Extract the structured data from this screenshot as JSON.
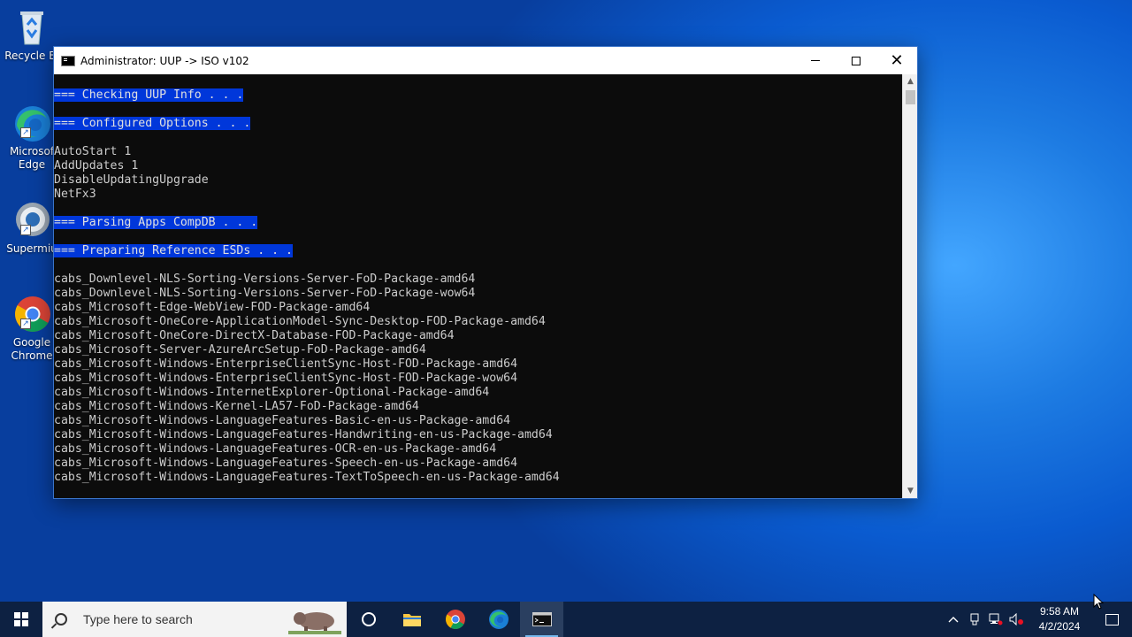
{
  "desktop": {
    "icons": [
      {
        "label": "Recycle Bi",
        "icon": "recycle-bin-icon"
      },
      {
        "label": "Microsof\nEdge",
        "icon": "edge-icon"
      },
      {
        "label": "Supermiu",
        "icon": "supermium-icon"
      },
      {
        "label": "Google\nChrome",
        "icon": "chrome-icon"
      }
    ]
  },
  "window": {
    "title": "Administrator:  UUP -> ISO v102",
    "icon": "cmd-icon",
    "controls": {
      "minimize": "minimize-icon",
      "maximize": "maximize-icon",
      "close": "close-icon"
    }
  },
  "console": {
    "lines": [
      {
        "text": "=== Checking UUP Info . . .",
        "highlight": true
      },
      {
        "text": "",
        "highlight": false
      },
      {
        "text": "=== Configured Options . . .",
        "highlight": true
      },
      {
        "text": "",
        "highlight": false
      },
      {
        "text": "AutoStart 1",
        "highlight": false
      },
      {
        "text": "AddUpdates 1",
        "highlight": false
      },
      {
        "text": "DisableUpdatingUpgrade",
        "highlight": false
      },
      {
        "text": "NetFx3",
        "highlight": false
      },
      {
        "text": "",
        "highlight": false
      },
      {
        "text": "=== Parsing Apps CompDB . . .",
        "highlight": true
      },
      {
        "text": "",
        "highlight": false
      },
      {
        "text": "=== Preparing Reference ESDs . . .",
        "highlight": true
      },
      {
        "text": "",
        "highlight": false
      },
      {
        "text": "cabs_Downlevel-NLS-Sorting-Versions-Server-FoD-Package-amd64",
        "highlight": false
      },
      {
        "text": "cabs_Downlevel-NLS-Sorting-Versions-Server-FoD-Package-wow64",
        "highlight": false
      },
      {
        "text": "cabs_Microsoft-Edge-WebView-FOD-Package-amd64",
        "highlight": false
      },
      {
        "text": "cabs_Microsoft-OneCore-ApplicationModel-Sync-Desktop-FOD-Package-amd64",
        "highlight": false
      },
      {
        "text": "cabs_Microsoft-OneCore-DirectX-Database-FOD-Package-amd64",
        "highlight": false
      },
      {
        "text": "cabs_Microsoft-Server-AzureArcSetup-FoD-Package-amd64",
        "highlight": false
      },
      {
        "text": "cabs_Microsoft-Windows-EnterpriseClientSync-Host-FOD-Package-amd64",
        "highlight": false
      },
      {
        "text": "cabs_Microsoft-Windows-EnterpriseClientSync-Host-FOD-Package-wow64",
        "highlight": false
      },
      {
        "text": "cabs_Microsoft-Windows-InternetExplorer-Optional-Package-amd64",
        "highlight": false
      },
      {
        "text": "cabs_Microsoft-Windows-Kernel-LA57-FoD-Package-amd64",
        "highlight": false
      },
      {
        "text": "cabs_Microsoft-Windows-LanguageFeatures-Basic-en-us-Package-amd64",
        "highlight": false
      },
      {
        "text": "cabs_Microsoft-Windows-LanguageFeatures-Handwriting-en-us-Package-amd64",
        "highlight": false
      },
      {
        "text": "cabs_Microsoft-Windows-LanguageFeatures-OCR-en-us-Package-amd64",
        "highlight": false
      },
      {
        "text": "cabs_Microsoft-Windows-LanguageFeatures-Speech-en-us-Package-amd64",
        "highlight": false
      },
      {
        "text": "cabs_Microsoft-Windows-LanguageFeatures-TextToSpeech-en-us-Package-amd64",
        "highlight": false
      }
    ]
  },
  "taskbar": {
    "search_placeholder": "Type here to search",
    "apps": [
      "task-view-icon",
      "file-explorer-icon",
      "chrome-icon",
      "edge-icon",
      "terminal-icon"
    ],
    "tray": {
      "icons": [
        "chevron-up-icon",
        "usb-device-icon",
        "network-icon",
        "volume-muted-icon"
      ],
      "time": "9:58 AM",
      "date": "4/2/2024"
    }
  },
  "colors": {
    "highlight_bg": "#0037da",
    "console_fg": "#cccccc",
    "console_bg": "#0c0c0c",
    "taskbar_bg": "#0d2142"
  }
}
